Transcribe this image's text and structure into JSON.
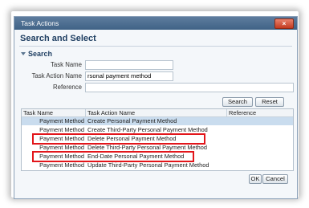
{
  "window": {
    "title": "Task Actions",
    "close_label": "×"
  },
  "heading": "Search and Select",
  "search": {
    "section_label": "Search",
    "fields": [
      {
        "label": "Task Name",
        "value": ""
      },
      {
        "label": "Task Action Name",
        "value": "rsonal payment method"
      },
      {
        "label": "Reference",
        "value": ""
      }
    ],
    "search_label": "Search",
    "reset_label": "Reset"
  },
  "table": {
    "columns": [
      "Task Name",
      "Task Action Name",
      "Reference"
    ],
    "rows": [
      {
        "task": "Payment Method",
        "action": "Create Personal Payment Method",
        "reference": "",
        "selected": true
      },
      {
        "task": "Payment Method",
        "action": "Create Third-Party Personal Payment Method",
        "reference": "",
        "selected": false
      },
      {
        "task": "Payment Method",
        "action": "Delete Personal Payment Method",
        "reference": "",
        "selected": false
      },
      {
        "task": "Payment Method",
        "action": "Delete Third-Party Personal Payment Method",
        "reference": "",
        "selected": false
      },
      {
        "task": "Payment Method",
        "action": "End-Date Personal Payment Method",
        "reference": "",
        "selected": false
      },
      {
        "task": "Payment Method",
        "action": "Update Third-Party Personal Payment Method",
        "reference": "",
        "selected": false
      }
    ]
  },
  "footer": {
    "ok_label": "OK",
    "cancel_label": "Cancel"
  },
  "colors": {
    "highlight": "#e2161b",
    "titlebar": "#3f6286",
    "selected_row": "#c9dcee"
  }
}
